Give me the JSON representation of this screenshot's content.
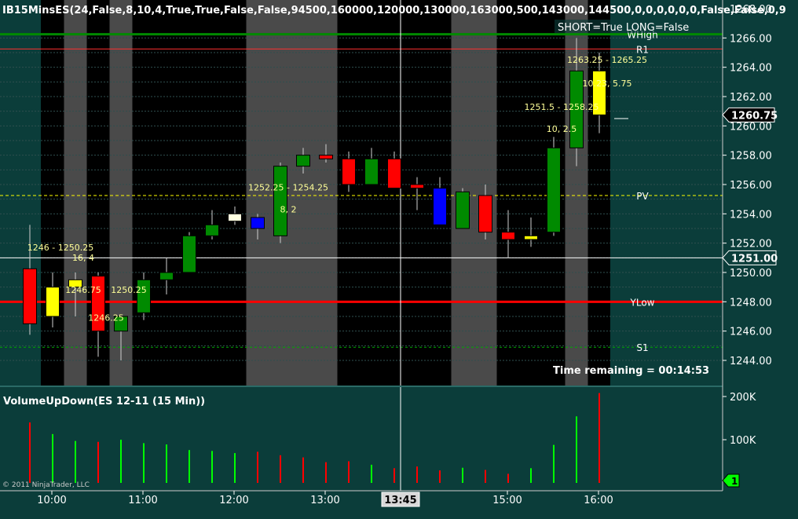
{
  "colors": {
    "background": "#0b3d3a",
    "plot": "#000000",
    "shade": "#4a4a4a",
    "up": "#008a00",
    "down": "#ff0000",
    "inside": "#ffff00",
    "outside": "#0000ff",
    "doji": "#ffffe0",
    "vol_up": "#00ff00",
    "vol_down": "#ff0000",
    "axis_text": "#ffffff",
    "label_text": "#ffff99"
  },
  "chart_data": [
    {
      "type": "candlestick",
      "title": "IB15MinsES(24,False,8,10,4,True,True,False,False,94500,160000,120000,130000,163000,500,143000,144500,0,0,0,0,0,0,False,False,0,9",
      "mode_label": "SHORT=True LONG=False",
      "timer_label": "Time remaining = 00:14:53",
      "x_ticks": [
        "10:00",
        "11:00",
        "12:00",
        "13:00",
        "13:45",
        "15:00",
        "16:00"
      ],
      "y_ticks": [
        "1244.00",
        "1246.00",
        "1248.00",
        "1250.00",
        "1252.00",
        "1254.00",
        "1256.00",
        "1258.00",
        "1260.00",
        "1262.00",
        "1264.00",
        "1266.00",
        "1268.00"
      ],
      "ylim": [
        1242.3,
        1268.3
      ],
      "last_price": "1260.75",
      "crosshair_price": "1251.00",
      "crosshair_time": "13:45",
      "candles": [
        {
          "o": 1250.25,
          "h": 1253.25,
          "l": 1245.75,
          "c": 1246.5,
          "t": "down"
        },
        {
          "o": 1247.0,
          "h": 1250.0,
          "l": 1246.25,
          "c": 1249.0,
          "t": "inside"
        },
        {
          "o": 1249.5,
          "h": 1250.0,
          "l": 1247.0,
          "c": 1249.0,
          "t": "inside"
        },
        {
          "o": 1249.75,
          "h": 1250.0,
          "l": 1244.25,
          "c": 1246.0,
          "t": "down"
        },
        {
          "o": 1246.0,
          "h": 1247.0,
          "l": 1244.0,
          "c": 1247.0,
          "t": "up"
        },
        {
          "o": 1247.25,
          "h": 1250.0,
          "l": 1246.75,
          "c": 1249.5,
          "t": "up"
        },
        {
          "o": 1249.5,
          "h": 1251.0,
          "l": 1248.5,
          "c": 1250.0,
          "t": "up"
        },
        {
          "o": 1250.0,
          "h": 1252.75,
          "l": 1250.0,
          "c": 1252.5,
          "t": "up"
        },
        {
          "o": 1252.5,
          "h": 1254.25,
          "l": 1252.25,
          "c": 1253.25,
          "t": "up"
        },
        {
          "o": 1253.5,
          "h": 1254.5,
          "l": 1253.25,
          "c": 1254.0,
          "t": "doji"
        },
        {
          "o": 1253.75,
          "h": 1254.0,
          "l": 1252.25,
          "c": 1253.0,
          "t": "outside"
        },
        {
          "o": 1252.5,
          "h": 1257.5,
          "l": 1252.0,
          "c": 1257.25,
          "t": "up"
        },
        {
          "o": 1257.25,
          "h": 1258.5,
          "l": 1256.75,
          "c": 1258.0,
          "t": "up"
        },
        {
          "o": 1258.0,
          "h": 1258.75,
          "l": 1257.5,
          "c": 1257.75,
          "t": "down"
        },
        {
          "o": 1257.75,
          "h": 1258.25,
          "l": 1255.5,
          "c": 1256.0,
          "t": "down"
        },
        {
          "o": 1256.0,
          "h": 1258.5,
          "l": 1256.0,
          "c": 1257.75,
          "t": "up"
        },
        {
          "o": 1257.75,
          "h": 1258.25,
          "l": 1255.75,
          "c": 1255.75,
          "t": "down"
        },
        {
          "o": 1256.0,
          "h": 1256.5,
          "l": 1254.25,
          "c": 1255.75,
          "t": "down"
        },
        {
          "o": 1255.75,
          "h": 1256.5,
          "l": 1253.25,
          "c": 1253.25,
          "t": "outside"
        },
        {
          "o": 1253.0,
          "h": 1255.75,
          "l": 1253.0,
          "c": 1255.5,
          "t": "up"
        },
        {
          "o": 1255.25,
          "h": 1256.0,
          "l": 1252.25,
          "c": 1252.75,
          "t": "down"
        },
        {
          "o": 1252.75,
          "h": 1254.25,
          "l": 1251.0,
          "c": 1252.25,
          "t": "down"
        },
        {
          "o": 1252.25,
          "h": 1253.75,
          "l": 1251.75,
          "c": 1252.5,
          "t": "inside"
        },
        {
          "o": 1252.75,
          "h": 1259.25,
          "l": 1252.5,
          "c": 1258.5,
          "t": "up"
        },
        {
          "o": 1258.5,
          "h": 1266.0,
          "l": 1257.25,
          "c": 1263.75,
          "t": "up"
        },
        {
          "o": 1263.75,
          "h": 1265.0,
          "l": 1259.5,
          "c": 1260.75,
          "t": "inside"
        }
      ],
      "shaded_bars": [
        2,
        4,
        10,
        11,
        12,
        13,
        19,
        20,
        24
      ],
      "levels": [
        {
          "name": "WHigh",
          "value": 1266.25,
          "label": "WHigh"
        },
        {
          "name": "R1",
          "value": 1265.25,
          "label": "R1"
        },
        {
          "name": "PV",
          "value": 1255.25,
          "label": "PV"
        },
        {
          "name": "Crosshair",
          "value": 1251.0,
          "label": ""
        },
        {
          "name": "YLow",
          "value": 1248.0,
          "label": "YLow"
        },
        {
          "name": "S1",
          "value": 1244.9,
          "label": "S1"
        }
      ],
      "annotations": [
        {
          "text": "1246 - 1250.25",
          "bar": 1,
          "price": 1251.5
        },
        {
          "text": "16, 4",
          "bar": 2,
          "price": 1250.8
        },
        {
          "text": "1246.75",
          "bar": 2,
          "price": 1248.6
        },
        {
          "text": "1250.25",
          "bar": 4,
          "price": 1248.6
        },
        {
          "text": "1246.25",
          "bar": 3,
          "price": 1246.7
        },
        {
          "text": "1252.25 - 1254.25",
          "bar": 11,
          "price": 1255.6
        },
        {
          "text": "8, 2",
          "bar": 11,
          "price": 1254.1
        },
        {
          "text": "1251.5 - 1258.25",
          "bar": 23,
          "price": 1261.1
        },
        {
          "text": "10, 2.5",
          "bar": 23,
          "price": 1259.6
        },
        {
          "text": "1263.25 - 1265.25",
          "bar": 25,
          "price": 1264.3
        },
        {
          "text": "10.23, 5.75",
          "bar": 25,
          "price": 1262.7
        }
      ]
    },
    {
      "type": "bar",
      "title": "VolumeUpDown(ES 12-11 (15 Min))",
      "y_ticks": [
        "100K",
        "200K"
      ],
      "ylim": [
        0,
        215000
      ],
      "last_value": "1",
      "values": [
        140000,
        113000,
        97000,
        95000,
        100000,
        92000,
        89000,
        76000,
        74000,
        69000,
        72000,
        64000,
        59000,
        48000,
        50000,
        42000,
        34000,
        38000,
        29000,
        35000,
        30000,
        21000,
        34000,
        88000,
        154000,
        208000
      ],
      "directions": [
        "down",
        "up",
        "up",
        "down",
        "up",
        "up",
        "up",
        "up",
        "up",
        "up",
        "down",
        "down",
        "down",
        "down",
        "down",
        "up",
        "down",
        "down",
        "down",
        "up",
        "down",
        "down",
        "up",
        "up",
        "up",
        "down"
      ]
    }
  ],
  "copyright": "© 2011 NinjaTrader, LLC"
}
